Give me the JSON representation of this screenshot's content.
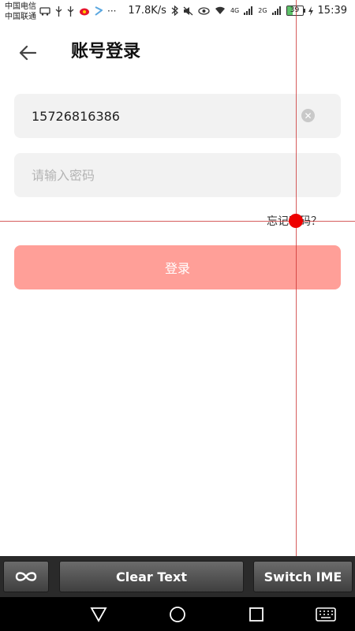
{
  "status_bar": {
    "carrier_1": "中国电信",
    "carrier_2": "中国联通",
    "net_speed": "17.8K/s",
    "net_type_1": "4G",
    "net_type_2": "2G",
    "battery": "39",
    "time": "15:39",
    "more": "···"
  },
  "header": {
    "title": "账号登录",
    "back_icon": "arrow-left-icon"
  },
  "login_form": {
    "phone_value": "15726816386",
    "password_placeholder": "请输入密码",
    "forgot_password": "忘记密码？",
    "login_button": "登录"
  },
  "ime_toolbar": {
    "loop_icon": "infinity-icon",
    "clear_text": "Clear Text",
    "switch_ime": "Switch IME"
  },
  "nav_bar": {
    "back_icon": "triangle-back-icon",
    "home_icon": "circle-home-icon",
    "recents_icon": "square-recents-icon",
    "keyboard_icon": "keyboard-icon"
  },
  "colors": {
    "login_button": "#ff9f98",
    "input_background": "#f2f2f2",
    "touch_indicator": "#ee0000"
  }
}
